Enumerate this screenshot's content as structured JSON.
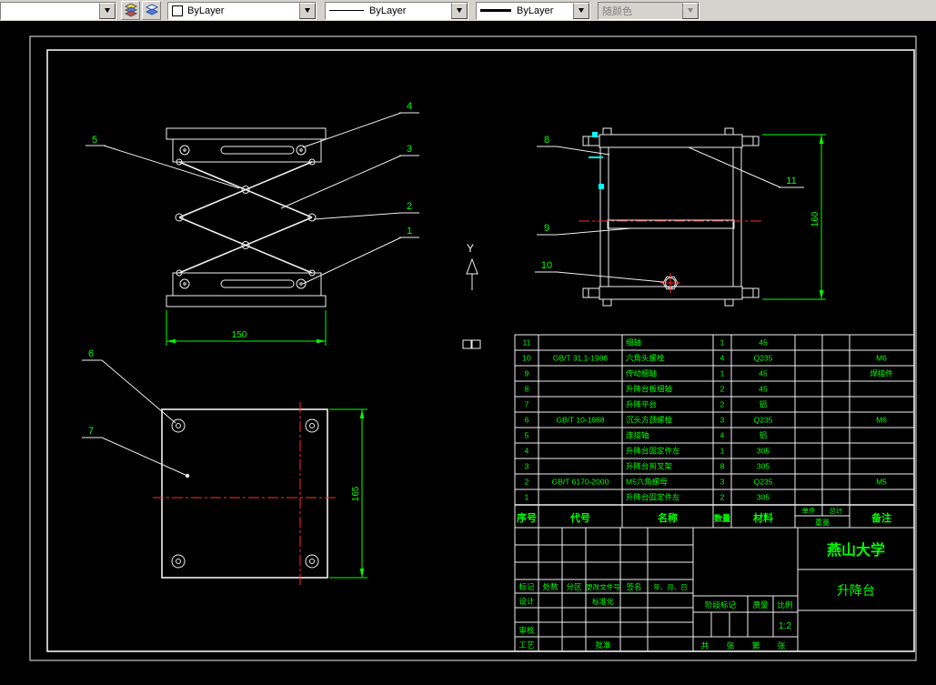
{
  "toolbar": {
    "layer_dropdown": {
      "value": ""
    },
    "color_control": {
      "value": "ByLayer"
    },
    "linetype_control": {
      "value": "ByLayer"
    },
    "lineweight_control": {
      "value": "ByLayer"
    },
    "plotstyle_control": {
      "value": "随颜色"
    }
  },
  "drawing": {
    "callouts": {
      "c1": "1",
      "c2": "2",
      "c3": "3",
      "c4": "4",
      "c5": "5",
      "c6": "6",
      "c7": "7",
      "c8": "8",
      "c9": "9",
      "c10": "10",
      "c11": "11"
    },
    "dimensions": {
      "front_width": "150",
      "top_height": "165",
      "side_height": "160"
    },
    "ucs": {
      "y_label": "Y"
    },
    "colors": {
      "line": "#f0f0f0",
      "annotation": "#00ff00",
      "centerline": "#ff2a2a",
      "highlight": "#00ffff"
    }
  },
  "bom": {
    "headers": {
      "no": "序号",
      "code": "代号",
      "name": "名称",
      "qty": "数量",
      "material": "材料",
      "unit": "单件",
      "total": "总计",
      "weight": "重量",
      "notes": "备注"
    },
    "rows": [
      {
        "no": "11",
        "code": "",
        "name": "细轴",
        "qty": "1",
        "material": "45",
        "notes": ""
      },
      {
        "no": "10",
        "code": "GB/T 31.1-1988",
        "name": "六角头螺栓",
        "qty": "4",
        "material": "Q235",
        "notes": "M6"
      },
      {
        "no": "9",
        "code": "",
        "name": "传动细轴",
        "qty": "1",
        "material": "45",
        "notes": "焊接件"
      },
      {
        "no": "8",
        "code": "",
        "name": "升降台板细轴",
        "qty": "2",
        "material": "45",
        "notes": ""
      },
      {
        "no": "7",
        "code": "",
        "name": "升降平台",
        "qty": "2",
        "material": "铝",
        "notes": ""
      },
      {
        "no": "6",
        "code": "GB/T 10-1988",
        "name": "沉头方颈螺栓",
        "qty": "3",
        "material": "Q235",
        "notes": "M6"
      },
      {
        "no": "5",
        "code": "",
        "name": "连接轴",
        "qty": "4",
        "material": "铝",
        "notes": ""
      },
      {
        "no": "4",
        "code": "",
        "name": "升降台固定件左",
        "qty": "1",
        "material": "305",
        "notes": ""
      },
      {
        "no": "3",
        "code": "",
        "name": "升降台剪叉架",
        "qty": "8",
        "material": "305",
        "notes": ""
      },
      {
        "no": "2",
        "code": "GB/T 6170-2000",
        "name": "M5六角螺母",
        "qty": "3",
        "material": "Q235",
        "notes": "M5"
      },
      {
        "no": "1",
        "code": "",
        "name": "升降台固定件左",
        "qty": "2",
        "material": "305",
        "notes": ""
      }
    ]
  },
  "titleblock": {
    "school": "燕山大学",
    "drawing_title": "升降台",
    "scale_value": "1:2",
    "labels": {
      "mark": "标记",
      "count": "处数",
      "zone": "分区",
      "change_file": "更改文件号",
      "signature": "签名",
      "date": "年、月、日",
      "design": "设计",
      "standardization": "标准化",
      "check": "审核",
      "process": "工艺",
      "approve": "批准",
      "stage_mark": "阶段标记",
      "mass": "质量",
      "scale": "比例",
      "total_label": "共",
      "sheet_label": "张",
      "page_label": "第",
      "sheet_label2": "张"
    }
  }
}
